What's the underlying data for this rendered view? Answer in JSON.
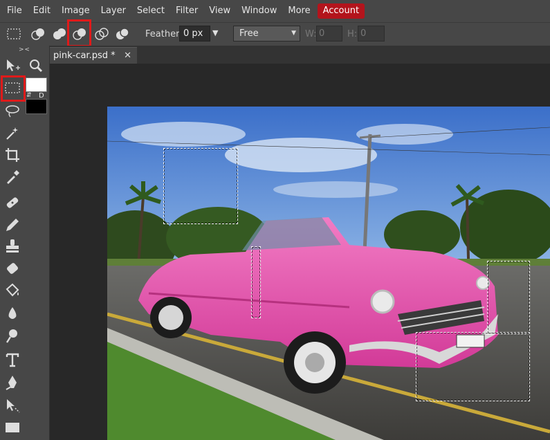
{
  "menu": {
    "items": [
      "File",
      "Edit",
      "Image",
      "Layer",
      "Select",
      "Filter",
      "View",
      "Window",
      "More"
    ],
    "account": "Account",
    "account_color": "#b3141c"
  },
  "options": {
    "mode_icons": [
      "new-selection-icon",
      "add-selection-icon",
      "subtract-selection-icon",
      "intersect-selection-icon",
      "exclude-selection-icon"
    ],
    "feather_label": "Feather:",
    "feather_value": "0 px",
    "style_value": "Free",
    "w_label": "W:",
    "w_value": "0",
    "h_label": "H:",
    "h_value": "0"
  },
  "tools": {
    "collapse": "> <",
    "items": [
      "move-tool-icon",
      "zoom-tool-icon",
      "rect-select-tool-icon",
      "lasso-tool-icon",
      "magic-wand-tool-icon",
      "crop-tool-icon",
      "eyedropper-tool-icon",
      "healing-tool-icon",
      "pencil-tool-icon",
      "stamp-tool-icon",
      "eraser-tool-icon",
      "bucket-tool-icon",
      "blur-tool-icon",
      "dodge-tool-icon",
      "type-tool-icon",
      "pen-tool-icon",
      "path-select-tool-icon",
      "shape-tool-icon"
    ],
    "fg_color": "#ffffff",
    "bg_color": "#000000",
    "default_label": "D"
  },
  "document": {
    "tab_name": "pink-car.psd *",
    "close": "✕"
  },
  "highlight_color": "#e01a1a"
}
